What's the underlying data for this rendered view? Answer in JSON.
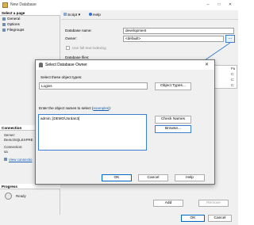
{
  "window": {
    "title": "New Database"
  },
  "left_pane": {
    "select_page_header": "Select a page",
    "pages": [
      "General",
      "Options",
      "Filegroups"
    ],
    "connection_header": "Connection",
    "server_label": "Server:",
    "server_value": "Demo\\SQLEXPRE",
    "connection_label": "Connection:",
    "connection_value": "sa",
    "view_connection_link": "View connectio",
    "progress_header": "Progress",
    "progress_status": "Ready"
  },
  "toolbar": {
    "script_label": "Script",
    "help_label": "Help"
  },
  "general": {
    "database_name_label": "Database name:",
    "database_name_value": "development",
    "owner_label": "Owner:",
    "owner_value": "<default>",
    "browse_glyph": "...",
    "fulltext_label": "Use full-text indexing",
    "database_files_label": "Database files:"
  },
  "background_grid": {
    "header_right": "ows",
    "header_far_right": "Pa",
    "rows": [
      {
        "text": "ata",
        "tail": "C:"
      },
      {
        "text": "ect",
        "tail": "C:"
      },
      {
        "text": "ect",
        "tail": "C:"
      }
    ]
  },
  "bottom_buttons": {
    "add": "Add",
    "remove": "Remove",
    "ok": "OK",
    "cancel": "Cancel"
  },
  "dialog": {
    "title": "Select Database Owner",
    "object_types_label": "Select these object types:",
    "object_types_value": "Logins",
    "object_types_button": "Object Types...",
    "enter_names_prefix": "Enter the object names to select (",
    "examples_link": "examples",
    "enter_names_suffix": "):",
    "object_name_value": "admin; [DEMO\\Jordan3]",
    "check_names_button": "Check Names",
    "browse_button": "Browse...",
    "ok_button": "OK",
    "cancel_button": "Cancel",
    "help_button": "Help"
  },
  "colors": {
    "accent": "#3c7fd0",
    "link": "#1a5fb4",
    "window_bg": "#f0f0f0"
  }
}
